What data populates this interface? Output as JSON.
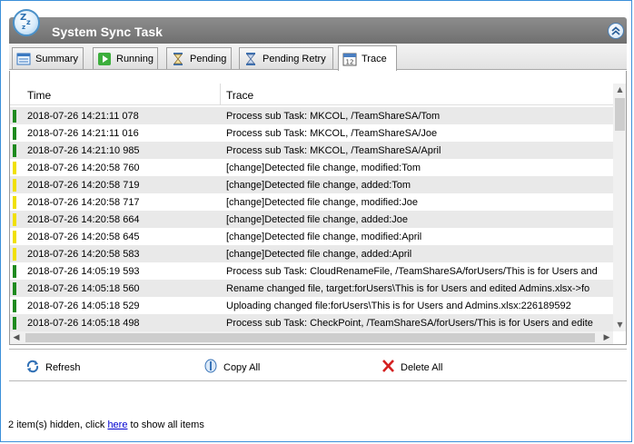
{
  "window": {
    "title": "System Sync Task",
    "accent_color": "#3b8fd9"
  },
  "tabs": [
    {
      "label": "Summary",
      "icon": "summary-icon",
      "active": false
    },
    {
      "label": "Running",
      "icon": "running-icon",
      "active": false
    },
    {
      "label": "Pending",
      "icon": "hourglass-icon",
      "active": false
    },
    {
      "label": "Pending Retry",
      "icon": "retry-hourglass-icon",
      "active": false
    },
    {
      "label": "Trace",
      "icon": "calendar-icon",
      "active": true
    }
  ],
  "table": {
    "columns": {
      "time": "Time",
      "trace": "Trace"
    },
    "rows": [
      {
        "time": "2018-07-26 14:21:11 078",
        "trace": "Process sub Task: MKCOL, /TeamShareSA/Tom",
        "level_color": "#1e8a1e"
      },
      {
        "time": "2018-07-26 14:21:11 016",
        "trace": "Process sub Task: MKCOL, /TeamShareSA/Joe",
        "level_color": "#1e8a1e"
      },
      {
        "time": "2018-07-26 14:21:10 985",
        "trace": "Process sub Task: MKCOL, /TeamShareSA/April",
        "level_color": "#1e8a1e"
      },
      {
        "time": "2018-07-26 14:20:58 760",
        "trace": "[change]Detected file change, modified:Tom",
        "level_color": "#f0e000"
      },
      {
        "time": "2018-07-26 14:20:58 719",
        "trace": "[change]Detected file change, added:Tom",
        "level_color": "#f0e000"
      },
      {
        "time": "2018-07-26 14:20:58 717",
        "trace": "[change]Detected file change, modified:Joe",
        "level_color": "#f0e000"
      },
      {
        "time": "2018-07-26 14:20:58 664",
        "trace": "[change]Detected file change, added:Joe",
        "level_color": "#f0e000"
      },
      {
        "time": "2018-07-26 14:20:58 645",
        "trace": "[change]Detected file change, modified:April",
        "level_color": "#f0e000"
      },
      {
        "time": "2018-07-26 14:20:58 583",
        "trace": "[change]Detected file change, added:April",
        "level_color": "#f0e000"
      },
      {
        "time": "2018-07-26 14:05:19 593",
        "trace": "Process sub Task: CloudRenameFile, /TeamShareSA/forUsers/This is for Users and",
        "level_color": "#1e8a1e"
      },
      {
        "time": "2018-07-26 14:05:18 560",
        "trace": "Rename changed file, target:forUsers\\This is for Users and edited Admins.xlsx->fo",
        "level_color": "#1e8a1e"
      },
      {
        "time": "2018-07-26 14:05:18 529",
        "trace": "Uploading changed file:forUsers\\This is for Users and Admins.xlsx:226189592",
        "level_color": "#1e8a1e"
      },
      {
        "time": "2018-07-26 14:05:18 498",
        "trace": "Process sub Task: CheckPoint, /TeamShareSA/forUsers/This is for Users and edite",
        "level_color": "#1e8a1e"
      }
    ]
  },
  "toolbar": {
    "refresh": "Refresh",
    "copy_all": "Copy All",
    "delete_all": "Delete All"
  },
  "status": {
    "prefix": "2 item(s) hidden, click ",
    "link": "here",
    "suffix": " to show all items"
  }
}
